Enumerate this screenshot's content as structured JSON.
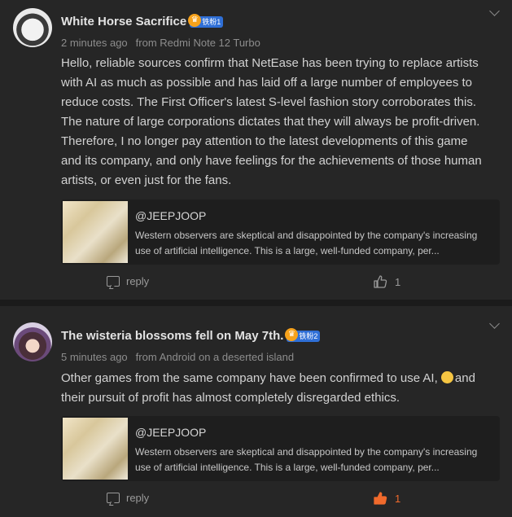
{
  "posts": [
    {
      "name": "White Horse Sacrifice",
      "badge": "铁粉1",
      "time": "2 minutes ago",
      "source": "from Redmi Note 12 Turbo",
      "text": "Hello, reliable sources confirm that NetEase has been trying to replace artists with AI as much as possible and has laid off a large number of employees to reduce costs. The First Officer's latest S-level fashion story corroborates this. The nature of large corporations dictates that they will always be profit-driven. Therefore, I no longer pay attention to the latest developments of this game and its company, and only have feelings for the achievements of those human artists, or even just for the fans.",
      "quote_user": "@JEEPJOOP",
      "quote_text": "Western observers are skeptical and disappointed by the company's increasing use of artificial intelligence. This is a large, well-funded company, per...",
      "reply_label": "reply",
      "likes": "1",
      "liked": false
    },
    {
      "name": "The wisteria blossoms fell on May 7th.",
      "badge": "铁粉2",
      "time": "5 minutes ago",
      "source": "from Android on a deserted island",
      "text_before": "Other games from the same company have been confirmed to use AI, ",
      "text_after": "and their pursuit of profit has almost completely disregarded ethics.",
      "quote_user": "@JEEPJOOP",
      "quote_text": "Western observers are skeptical and disappointed by the company's increasing use of artificial intelligence. This is a large, well-funded company, per...",
      "reply_label": "reply",
      "likes": "1",
      "liked": true
    }
  ],
  "colors": {
    "background": "#262626",
    "liked": "#f06a2c",
    "badge": "#2f6fd6",
    "badge_crown": "#f7a21b"
  }
}
